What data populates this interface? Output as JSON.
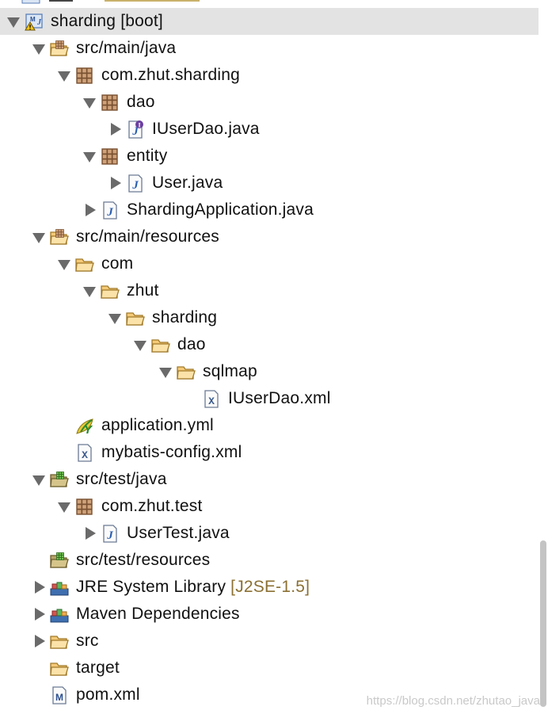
{
  "tree": {
    "nodes": [
      {
        "name": "tree-node-sharding-project",
        "label": "sharding [boot]",
        "icon": "maven-project-warning-icon",
        "level": 0,
        "state": "open",
        "selected": true
      },
      {
        "name": "tree-node-src-main-java",
        "label": "src/main/java",
        "icon": "source-folder-icon",
        "level": 1,
        "state": "open"
      },
      {
        "name": "tree-node-com-zhut-sharding",
        "label": "com.zhut.sharding",
        "icon": "package-icon",
        "level": 2,
        "state": "open"
      },
      {
        "name": "tree-node-dao-package",
        "label": "dao",
        "icon": "package-icon",
        "level": 3,
        "state": "open"
      },
      {
        "name": "tree-node-iuserdao-java",
        "label": "IUserDao.java",
        "icon": "java-interface-file-icon",
        "level": 4,
        "state": "closed"
      },
      {
        "name": "tree-node-entity-package",
        "label": "entity",
        "icon": "package-icon",
        "level": 3,
        "state": "open"
      },
      {
        "name": "tree-node-user-java",
        "label": "User.java",
        "icon": "java-file-icon",
        "level": 4,
        "state": "closed"
      },
      {
        "name": "tree-node-shardingapplication-java",
        "label": "ShardingApplication.java",
        "icon": "java-file-icon",
        "level": 3,
        "state": "closed"
      },
      {
        "name": "tree-node-src-main-resources",
        "label": "src/main/resources",
        "icon": "source-folder-icon",
        "level": 1,
        "state": "open"
      },
      {
        "name": "tree-node-com-folder",
        "label": "com",
        "icon": "open-folder-icon",
        "level": 2,
        "state": "open"
      },
      {
        "name": "tree-node-zhut-folder",
        "label": "zhut",
        "icon": "open-folder-icon",
        "level": 3,
        "state": "open"
      },
      {
        "name": "tree-node-sharding-folder",
        "label": "sharding",
        "icon": "open-folder-icon",
        "level": 4,
        "state": "open"
      },
      {
        "name": "tree-node-dao-folder",
        "label": "dao",
        "icon": "open-folder-icon",
        "level": 5,
        "state": "open"
      },
      {
        "name": "tree-node-sqlmap-folder",
        "label": "sqlmap",
        "icon": "open-folder-icon",
        "level": 6,
        "state": "open"
      },
      {
        "name": "tree-node-iuserdao-xml",
        "label": "IUserDao.xml",
        "icon": "xml-file-icon",
        "level": 7,
        "state": "none"
      },
      {
        "name": "tree-node-application-yml",
        "label": "application.yml",
        "icon": "yaml-file-icon",
        "level": 2,
        "state": "none"
      },
      {
        "name": "tree-node-mybatis-config-xml",
        "label": "mybatis-config.xml",
        "icon": "xml-file-icon",
        "level": 2,
        "state": "none"
      },
      {
        "name": "tree-node-src-test-java",
        "label": "src/test/java",
        "icon": "test-source-folder-icon",
        "level": 1,
        "state": "open"
      },
      {
        "name": "tree-node-com-zhut-test",
        "label": "com.zhut.test",
        "icon": "package-icon",
        "level": 2,
        "state": "open"
      },
      {
        "name": "tree-node-usertest-java",
        "label": "UserTest.java",
        "icon": "java-file-icon",
        "level": 3,
        "state": "closed"
      },
      {
        "name": "tree-node-src-test-resources",
        "label": "src/test/resources",
        "icon": "test-source-folder-icon",
        "level": 1,
        "state": "none"
      },
      {
        "name": "tree-node-jre-system-library",
        "label": "JRE System Library",
        "decoration": "[J2SE-1.5]",
        "icon": "library-icon",
        "level": 1,
        "state": "closed"
      },
      {
        "name": "tree-node-maven-dependencies",
        "label": "Maven Dependencies",
        "icon": "library-icon",
        "level": 1,
        "state": "closed"
      },
      {
        "name": "tree-node-src-folder",
        "label": "src",
        "icon": "open-folder-icon",
        "level": 1,
        "state": "closed"
      },
      {
        "name": "tree-node-target-folder",
        "label": "target",
        "icon": "open-folder-icon",
        "level": 1,
        "state": "none"
      },
      {
        "name": "tree-node-pom-xml",
        "label": "pom.xml",
        "icon": "maven-pom-file-icon",
        "level": 1,
        "state": "none"
      }
    ]
  },
  "watermark": "https://blog.csdn.net/zhutao_java",
  "colors": {
    "selection": "#e3e3e3",
    "decoration": "#8b7032",
    "folder": "#f4c977",
    "folder_stroke": "#a07a2a",
    "package": "#b28a5e",
    "java_blue": "#2a5db0",
    "arrow": "#6a6a6a"
  }
}
